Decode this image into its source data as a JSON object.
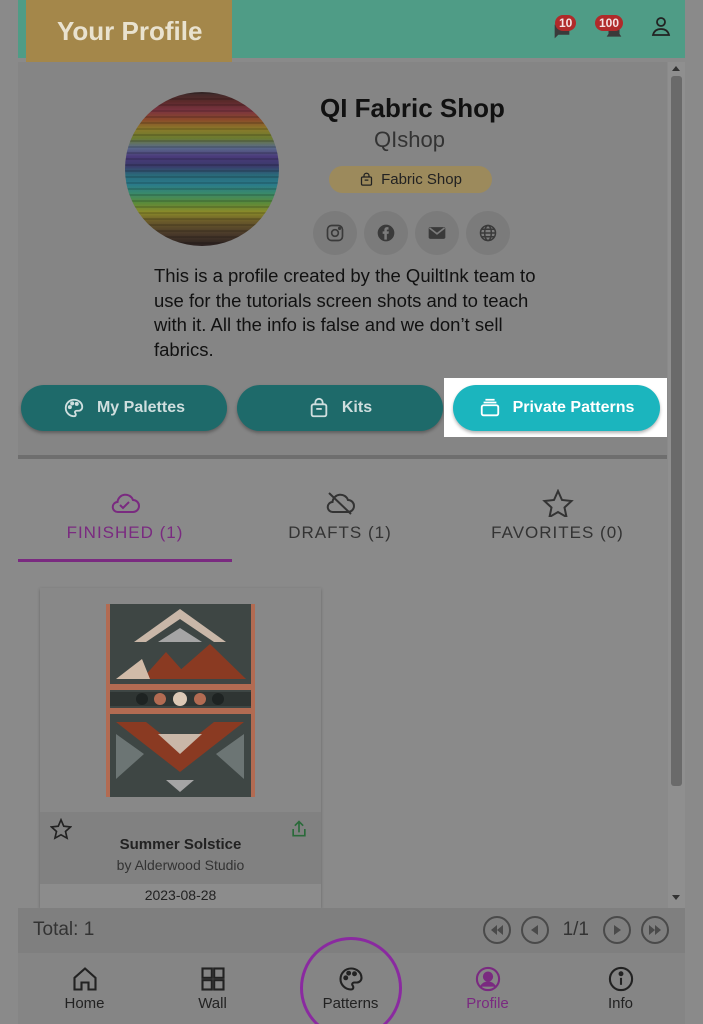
{
  "header": {
    "title": "Your Profile",
    "notif_badge_1": "10",
    "notif_badge_2": "100"
  },
  "profile": {
    "name": "QI Fabric Shop",
    "handle": "QIshop",
    "tag": "Fabric Shop",
    "socials": [
      "instagram-icon",
      "facebook-icon",
      "email-icon",
      "globe-icon"
    ],
    "bio": "This is a profile created by the QuiltInk team to use for the tutorials screen shots and to teach with it. All the info is false and we don’t sell fabrics."
  },
  "actions": {
    "palettes": "My Palettes",
    "kits": "Kits",
    "private": "Private Patterns"
  },
  "tabs": {
    "finished": "FINISHED (1)",
    "drafts": "DRAFTS (1)",
    "favorites": "FAVORITES (0)"
  },
  "card": {
    "title": "Summer Solstice",
    "author": "by Alderwood Studio",
    "date": "2023-08-28"
  },
  "pager": {
    "total": "Total: 1",
    "page": "1/1"
  },
  "nav": {
    "home": "Home",
    "wall": "Wall",
    "patterns": "Patterns",
    "profile": "Profile",
    "info": "Info"
  },
  "colors": {
    "accent": "#7a2a80",
    "teal_button": "#1e6a6a",
    "highlight_button": "#1bb5be"
  }
}
